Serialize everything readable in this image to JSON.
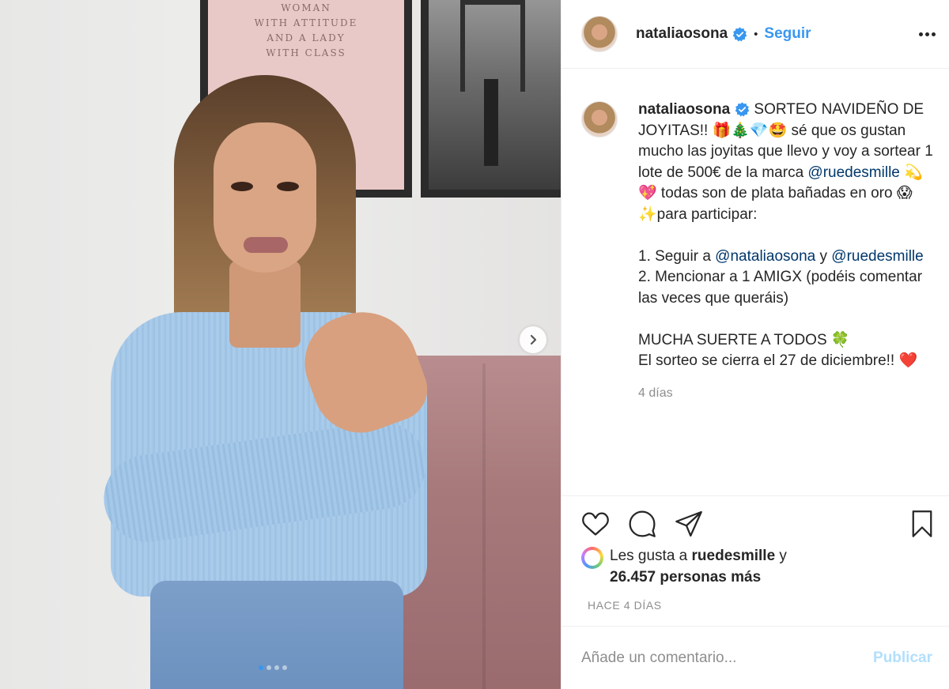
{
  "poster_text": [
    "WOMAN",
    "WITH ATTITUDE",
    "AND A LADY",
    "WITH CLASS"
  ],
  "header": {
    "username": "nataliaosona",
    "separator": "•",
    "follow_label": "Seguir"
  },
  "caption": {
    "username": "nataliaosona",
    "text_1": " SORTEO NAVIDEÑO DE JOYITAS!! 🎁🎄💎🤩 sé que os gustan mucho las joyitas que llevo y voy a sortear 1 lote de 500€ de la marca ",
    "mention_1": "@ruedesmille",
    "text_2": " 💫💖 todas son de plata bañadas en oro 😱✨para participar:\n\n1. Seguir a ",
    "mention_2": "@nataliaosona",
    "text_3": " y ",
    "mention_3": "@ruedesmille",
    "text_4": "\n2. Mencionar a 1 AMIGX (podéis comentar las veces que queráis)\n\nMUCHA SUERTE A TODOS 🍀\nEl sorteo se cierra el 27 de diciembre!! ❤️",
    "time": "4 días"
  },
  "icons": {
    "like": "heart-icon",
    "comment": "comment-icon",
    "share": "share-icon",
    "save": "bookmark-icon",
    "more": "more-options-icon",
    "verified": "verified-badge-icon",
    "next": "chevron-right-icon"
  },
  "likes": {
    "prefix": "Les gusta a ",
    "user": "ruedesmille",
    "middle": " y",
    "count": "26.457 personas más"
  },
  "timestamp": "HACE 4 DÍAS",
  "comment": {
    "placeholder": "Añade un comentario...",
    "publish_label": "Publicar"
  },
  "carousel": {
    "slides": 4,
    "active_index": 0
  },
  "colors": {
    "accent": "#3897f0",
    "mention": "#00376b",
    "muted": "#8e8e8e",
    "publish_disabled": "#b2dffc"
  }
}
